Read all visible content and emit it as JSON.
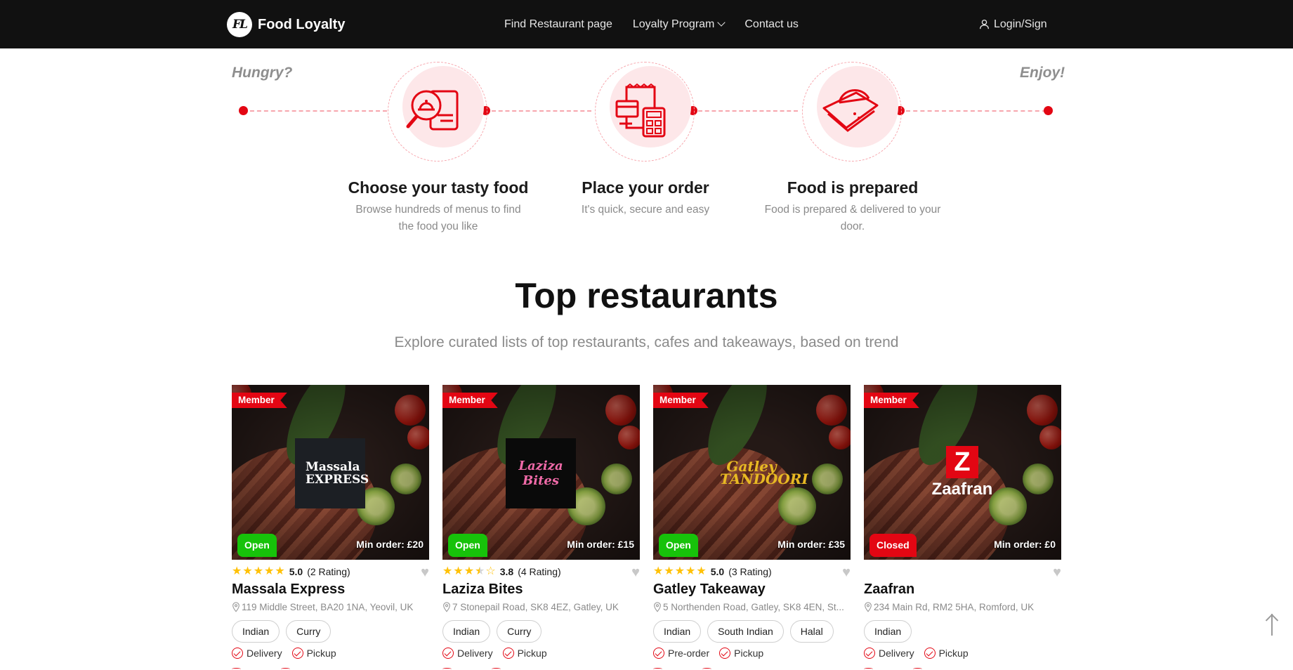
{
  "header": {
    "brand_logo_text": "FL",
    "brand_name": "Food Loyalty",
    "nav": {
      "find_restaurant": "Find Restaurant page",
      "loyalty_program": "Loyalty Program",
      "contact_us": "Contact us"
    },
    "login_label": "Login/Sign"
  },
  "steps_intro": {
    "start_label": "Hungry?",
    "end_label": "Enjoy!",
    "steps": [
      {
        "icon": "search-menu-icon",
        "title": "Choose your tasty food",
        "description": "Browse hundreds of menus to find the food you like"
      },
      {
        "icon": "order-calculator-icon",
        "title": "Place your order",
        "description": "It's quick, secure and easy"
      },
      {
        "icon": "food-wrap-icon",
        "title": "Food is prepared",
        "description": "Food is prepared & delivered to your door."
      }
    ]
  },
  "top_restaurants": {
    "title": "Top restaurants",
    "subtitle": "Explore curated lists of top restaurants, cafes and takeaways, based on trend",
    "restaurants": [
      {
        "badge": "Member",
        "status": "Open",
        "min_order": "Min order: £20",
        "logo_text": "Massala EXPRESS",
        "rating_stars": 5,
        "rating_score": "5.0",
        "rating_count": "(2 Rating)",
        "name": "Massala Express",
        "address": "119 Middle Street, BA20 1NA, Yeovil, UK",
        "tags": [
          "Indian",
          "Curry"
        ],
        "services": [
          "Delivery",
          "Pickup"
        ]
      },
      {
        "badge": "Member",
        "status": "Open",
        "min_order": "Min order: £15",
        "logo_text": "Laziza Bites",
        "rating_stars": 3.5,
        "rating_score": "3.8",
        "rating_count": "(4 Rating)",
        "name": "Laziza Bites",
        "address": "7 Stonepail Road, SK8 4EZ, Gatley, UK",
        "tags": [
          "Indian",
          "Curry"
        ],
        "services": [
          "Delivery",
          "Pickup"
        ]
      },
      {
        "badge": "Member",
        "status": "Open",
        "min_order": "Min order: £35",
        "logo_text": "Gatley TANDOORI",
        "rating_stars": 5,
        "rating_score": "5.0",
        "rating_count": "(3 Rating)",
        "name": "Gatley Takeaway",
        "address": "5 Northenden Road, Gatley, SK8 4EN, St...",
        "tags": [
          "Indian",
          "South Indian",
          "Halal"
        ],
        "services": [
          "Pre-order",
          "Pickup"
        ]
      },
      {
        "badge": "Member",
        "status": "Closed",
        "min_order": "Min order: £0",
        "logo_text": "Zaafran",
        "rating_stars": 0,
        "rating_score": "",
        "rating_count": "",
        "name": "Zaafran",
        "address": "234 Main Rd, RM2 5HA, Romford, UK",
        "tags": [
          "Indian"
        ],
        "services": [
          "Delivery",
          "Pickup"
        ]
      }
    ]
  },
  "colors": {
    "brand_red": "#e30613",
    "header_bg": "#111111",
    "open_green": "#17c20a",
    "closed_red": "#e30613",
    "star_yellow": "#ffc107"
  }
}
